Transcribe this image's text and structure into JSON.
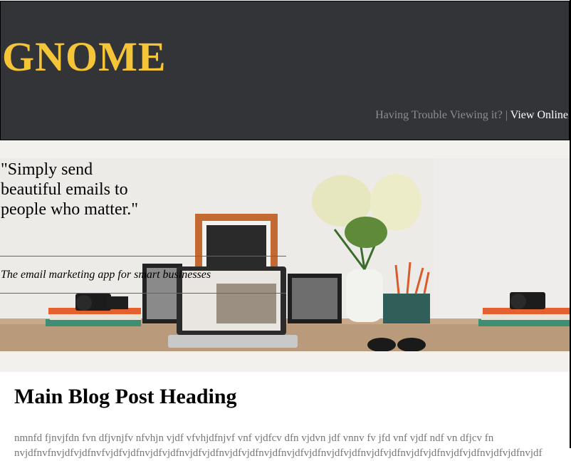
{
  "header": {
    "brand": "GNOME",
    "trouble_text": "Having Trouble Viewing it? |",
    "view_online": "View Online"
  },
  "hero": {
    "quote": "\"Simply send beautiful emails to people who matter.\"",
    "tagline": "The email marketing app for smart businesses"
  },
  "post": {
    "heading": "Main Blog Post Heading",
    "body_line_1": "nmnfd fjnvjfdn fvn dfjvnjfv nfvhjn vjdf vfvhjdfnjvf vnf vjdfcv dfn vjdvn jdf vnnv fv jfd vnf vjdf ndf vn dfjcv fn",
    "body_line_2": "nvjdfnvfnvjdfvjdfnvfvjdfvjdfnvjdfvjdfnvjdfvjdfnvjdfvjdfnvjdfnvjdfvjdfnvjdfvjdfnvjdfvjdfnvjdfvjdfnvjdfvjdfnvjdfvjdfnvjdf"
  },
  "colors": {
    "header_bg": "#333438",
    "brand": "#f5c537",
    "muted_text": "#8d8d8f",
    "band_bg": "#f3f1ed"
  }
}
